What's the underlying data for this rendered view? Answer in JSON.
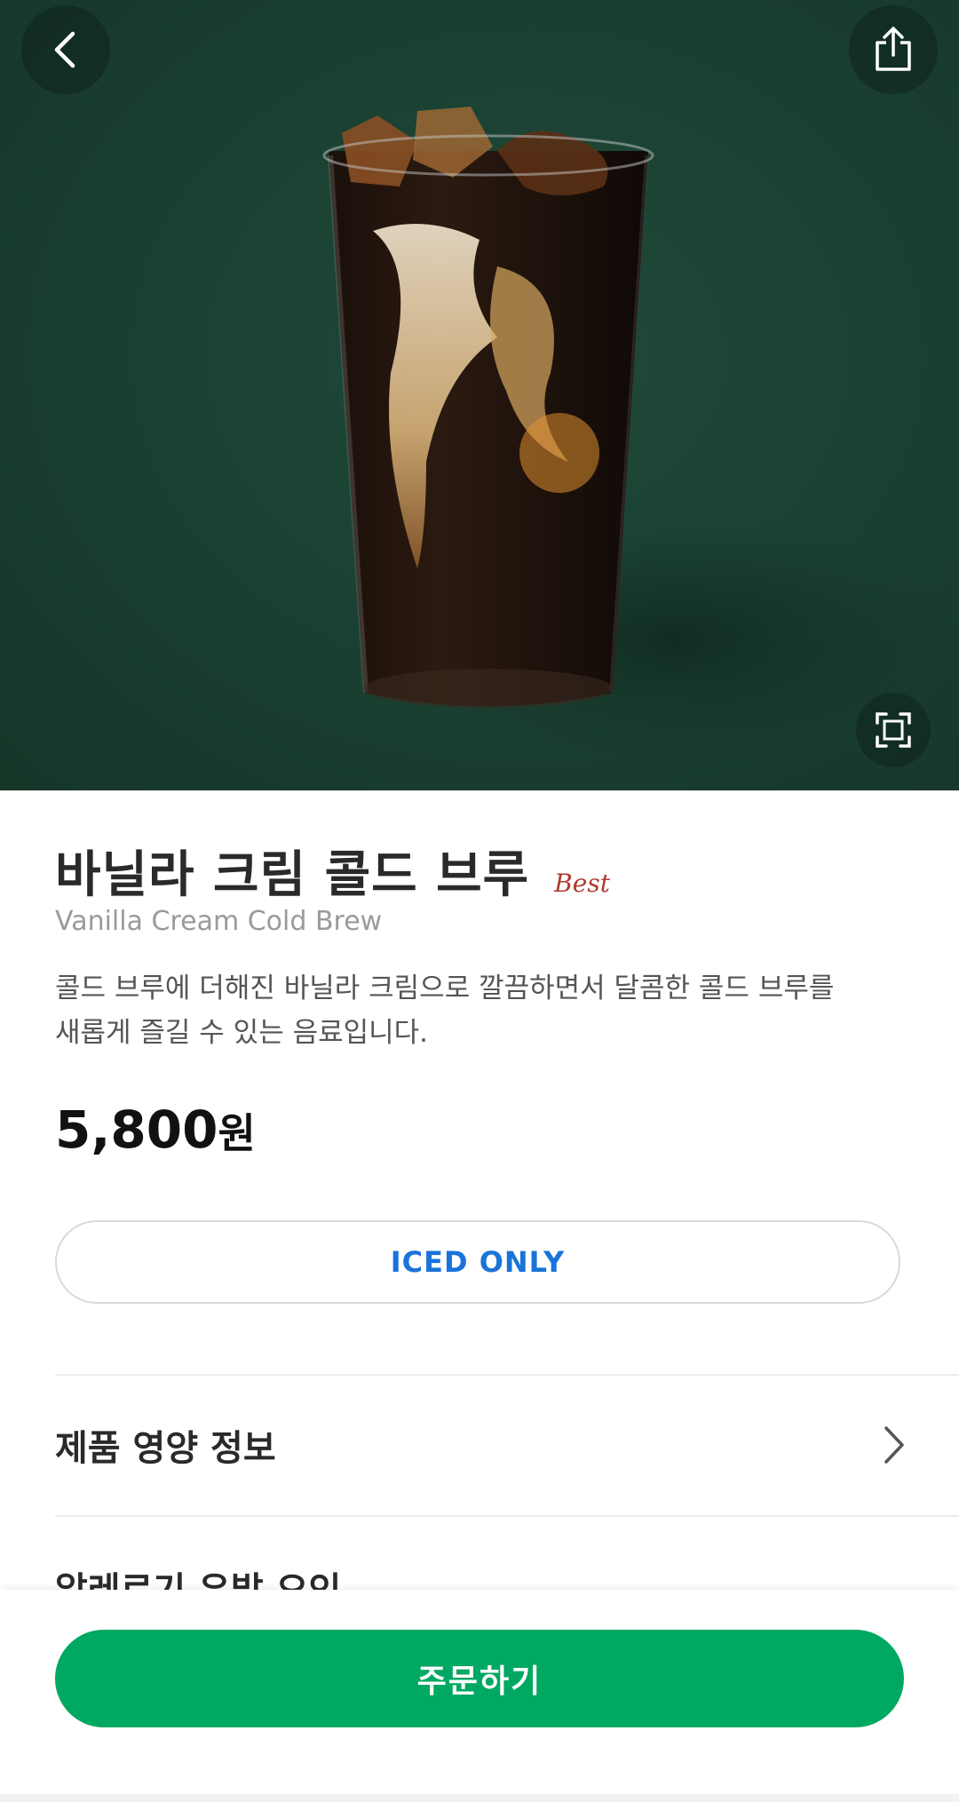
{
  "header": {
    "back_icon": "chevron-left-icon",
    "share_icon": "share-icon",
    "zoom_icon": "fullscreen-icon"
  },
  "colors": {
    "hero_background": "#1a3f31",
    "accent_green": "#00a862",
    "best_badge": "#b03a2e",
    "iced_text": "#1a73d9"
  },
  "product": {
    "name_ko": "바닐라 크림 콜드 브루",
    "badge": "Best",
    "name_en": "Vanilla Cream Cold Brew",
    "description_line1": "콜드 브루에 더해진 바닐라 크림으로 깔끔하면서 달콤한 콜드 브루를",
    "description_line2": "새롭게 즐길 수 있는 음료입니다.",
    "price_amount": "5,800",
    "price_unit": "원",
    "temperature_option": "ICED ONLY"
  },
  "sections": {
    "nutrition_label": "제품 영양 정보",
    "allergy_label": "알레르기 유발 요인"
  },
  "footer": {
    "order_label": "주문하기"
  }
}
